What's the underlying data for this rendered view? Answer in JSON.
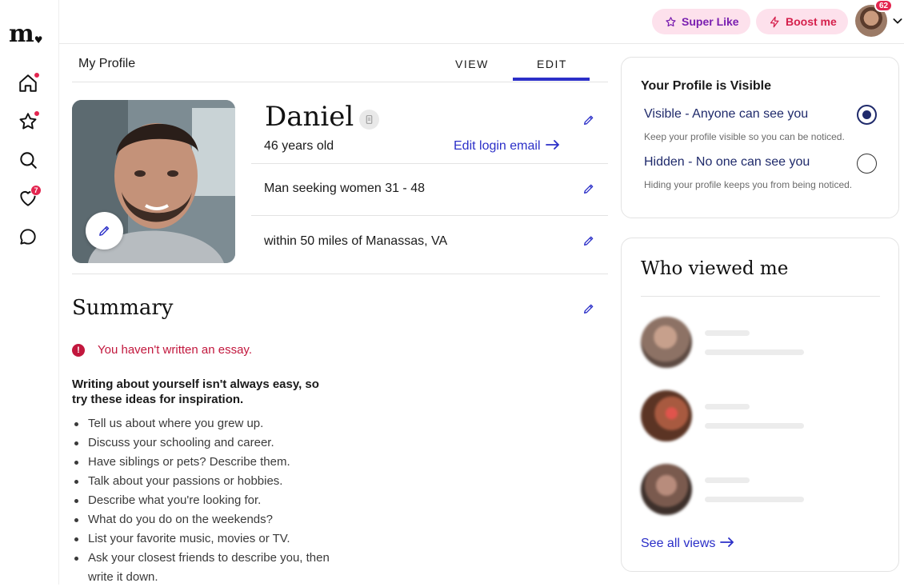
{
  "brand": {
    "logo_text": "m",
    "logo_heart": "♥"
  },
  "sidebar": {
    "items": [
      {
        "icon": "home-icon",
        "dot": true
      },
      {
        "icon": "star-icon",
        "dot": true
      },
      {
        "icon": "search-icon",
        "dot": false
      },
      {
        "icon": "heart-icon",
        "badge": "7"
      },
      {
        "icon": "chat-icon",
        "dot": false
      }
    ]
  },
  "topbar": {
    "super_like_label": "Super Like",
    "boost_label": "Boost me",
    "notification_count": "62"
  },
  "header": {
    "title": "My Profile",
    "tabs": [
      {
        "label": "VIEW"
      },
      {
        "label": "EDIT",
        "active": true
      }
    ]
  },
  "profile": {
    "name": "Daniel",
    "age": "46 years old",
    "edit_login_email": "Edit login email",
    "seeking": "Man seeking women 31 - 48",
    "location": "within 50 miles of Manassas, VA"
  },
  "summary": {
    "title": "Summary",
    "warning": "You haven't written an essay.",
    "inspiration": "Writing about yourself isn't always easy, so try these ideas for inspiration.",
    "ideas": [
      "Tell us about where you grew up.",
      "Discuss your schooling and career.",
      "Have siblings or pets? Describe them.",
      "Talk about your passions or hobbies.",
      "Describe what you're looking for.",
      "What do you do on the weekends?",
      "List your favorite music, movies or TV.",
      "Ask your closest friends to describe you, then write it down."
    ]
  },
  "visibility": {
    "title": "Your Profile is Visible",
    "options": [
      {
        "label": "Visible - Anyone can see you",
        "hint": "Keep your profile visible so you can be noticed.",
        "selected": true
      },
      {
        "label": "Hidden - No one can see you",
        "hint": "Hiding your profile keeps you from being noticed.",
        "selected": false
      }
    ]
  },
  "who_viewed": {
    "title": "Who viewed me",
    "see_all": "See all views"
  },
  "colors": {
    "accent": "#2b2fc8",
    "alert": "#e3254f",
    "warning_text": "#c2173d",
    "pill_bg": "#fde1ec"
  }
}
